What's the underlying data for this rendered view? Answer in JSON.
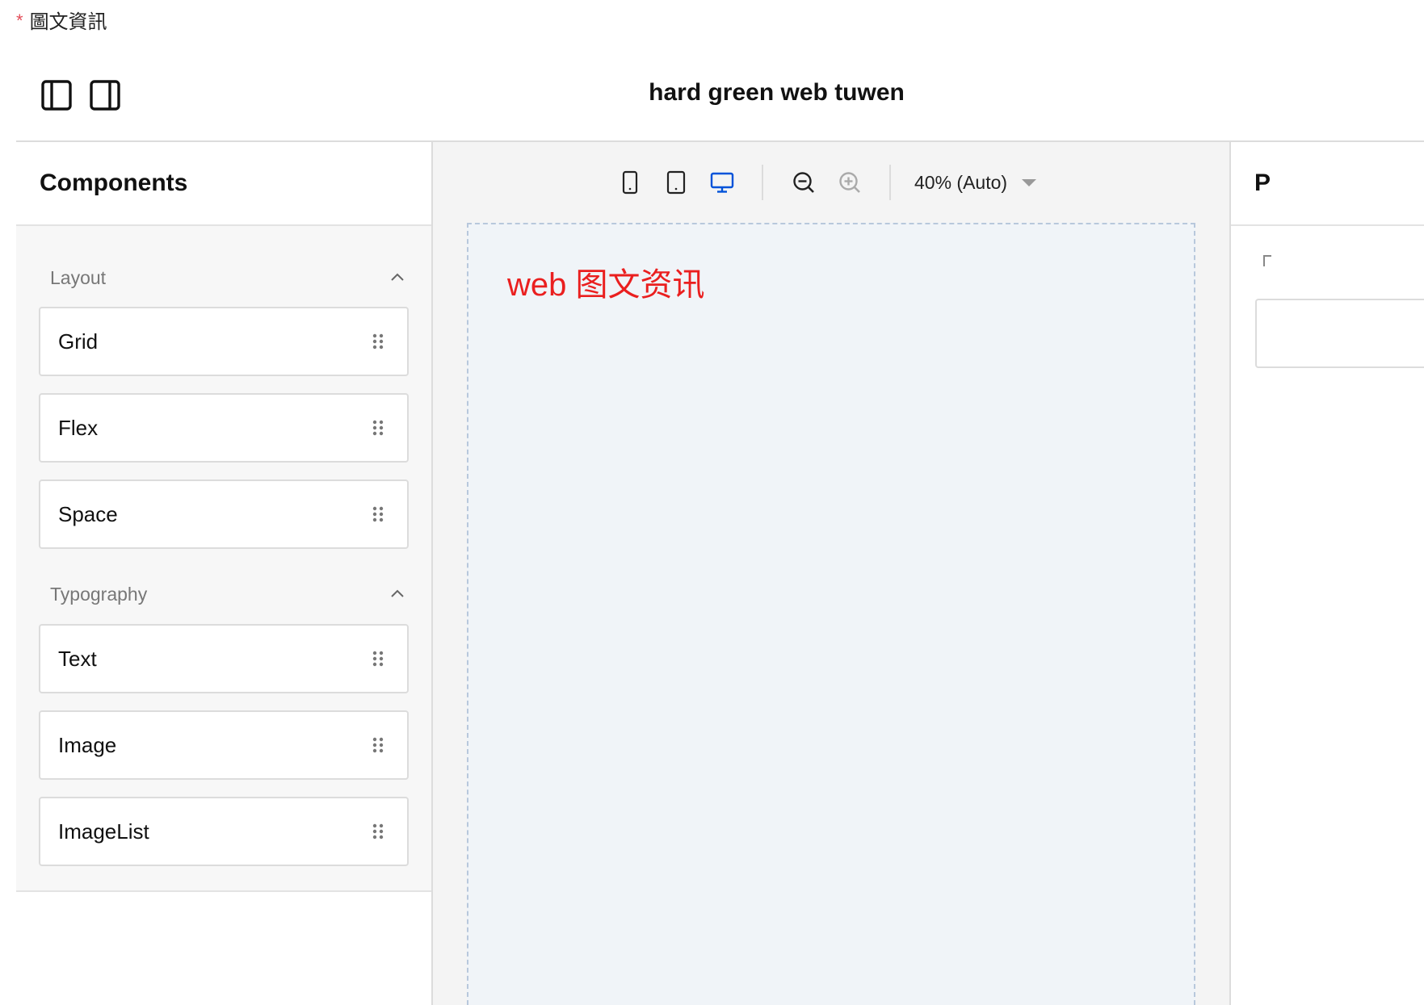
{
  "form": {
    "required_mark": "*",
    "label": "圖文資訊"
  },
  "header": {
    "title": "hard green web tuwen"
  },
  "components_panel": {
    "title": "Components",
    "groups": [
      {
        "label": "Layout",
        "items": [
          "Grid",
          "Flex",
          "Space"
        ]
      },
      {
        "label": "Typography",
        "items": [
          "Text",
          "Image",
          "ImageList"
        ]
      }
    ]
  },
  "toolbar": {
    "devices": [
      "mobile-icon",
      "tablet-icon",
      "desktop-icon"
    ],
    "active_device": "desktop",
    "zoom": "40% (Auto)",
    "accent_color": "#0052d9"
  },
  "canvas": {
    "text": "web 图文资讯",
    "text_color": "#ea1f1f"
  },
  "right_panel": {
    "title": "P"
  }
}
